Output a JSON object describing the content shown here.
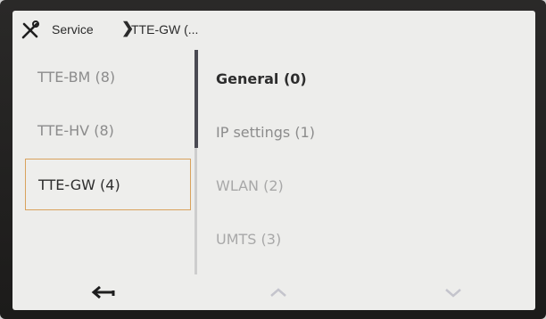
{
  "header": {
    "tools_icon": "tools-icon",
    "home_label": "Service",
    "separator": "❯",
    "current_label": "TTE-GW (..."
  },
  "left_list": {
    "items": [
      {
        "label": "TTE-BM (8)",
        "selected": false
      },
      {
        "label": "TTE-HV (8)",
        "selected": false
      },
      {
        "label": "TTE-GW (4)",
        "selected": true
      }
    ]
  },
  "right_list": {
    "items": [
      {
        "label": "General (0)",
        "state": "active"
      },
      {
        "label": "IP settings (1)",
        "state": "normal"
      },
      {
        "label": "WLAN (2)",
        "state": "faded"
      },
      {
        "label": "UMTS (3)",
        "state": "faded"
      }
    ]
  },
  "footer": {
    "back_icon": "back-arrow-icon",
    "up_icon": "chevron-up-icon",
    "down_icon": "chevron-down-icon"
  },
  "colors": {
    "selection_border": "#d9a25c",
    "scroll_thumb": "#4a4a52",
    "screen_bg": "#ededeb"
  }
}
